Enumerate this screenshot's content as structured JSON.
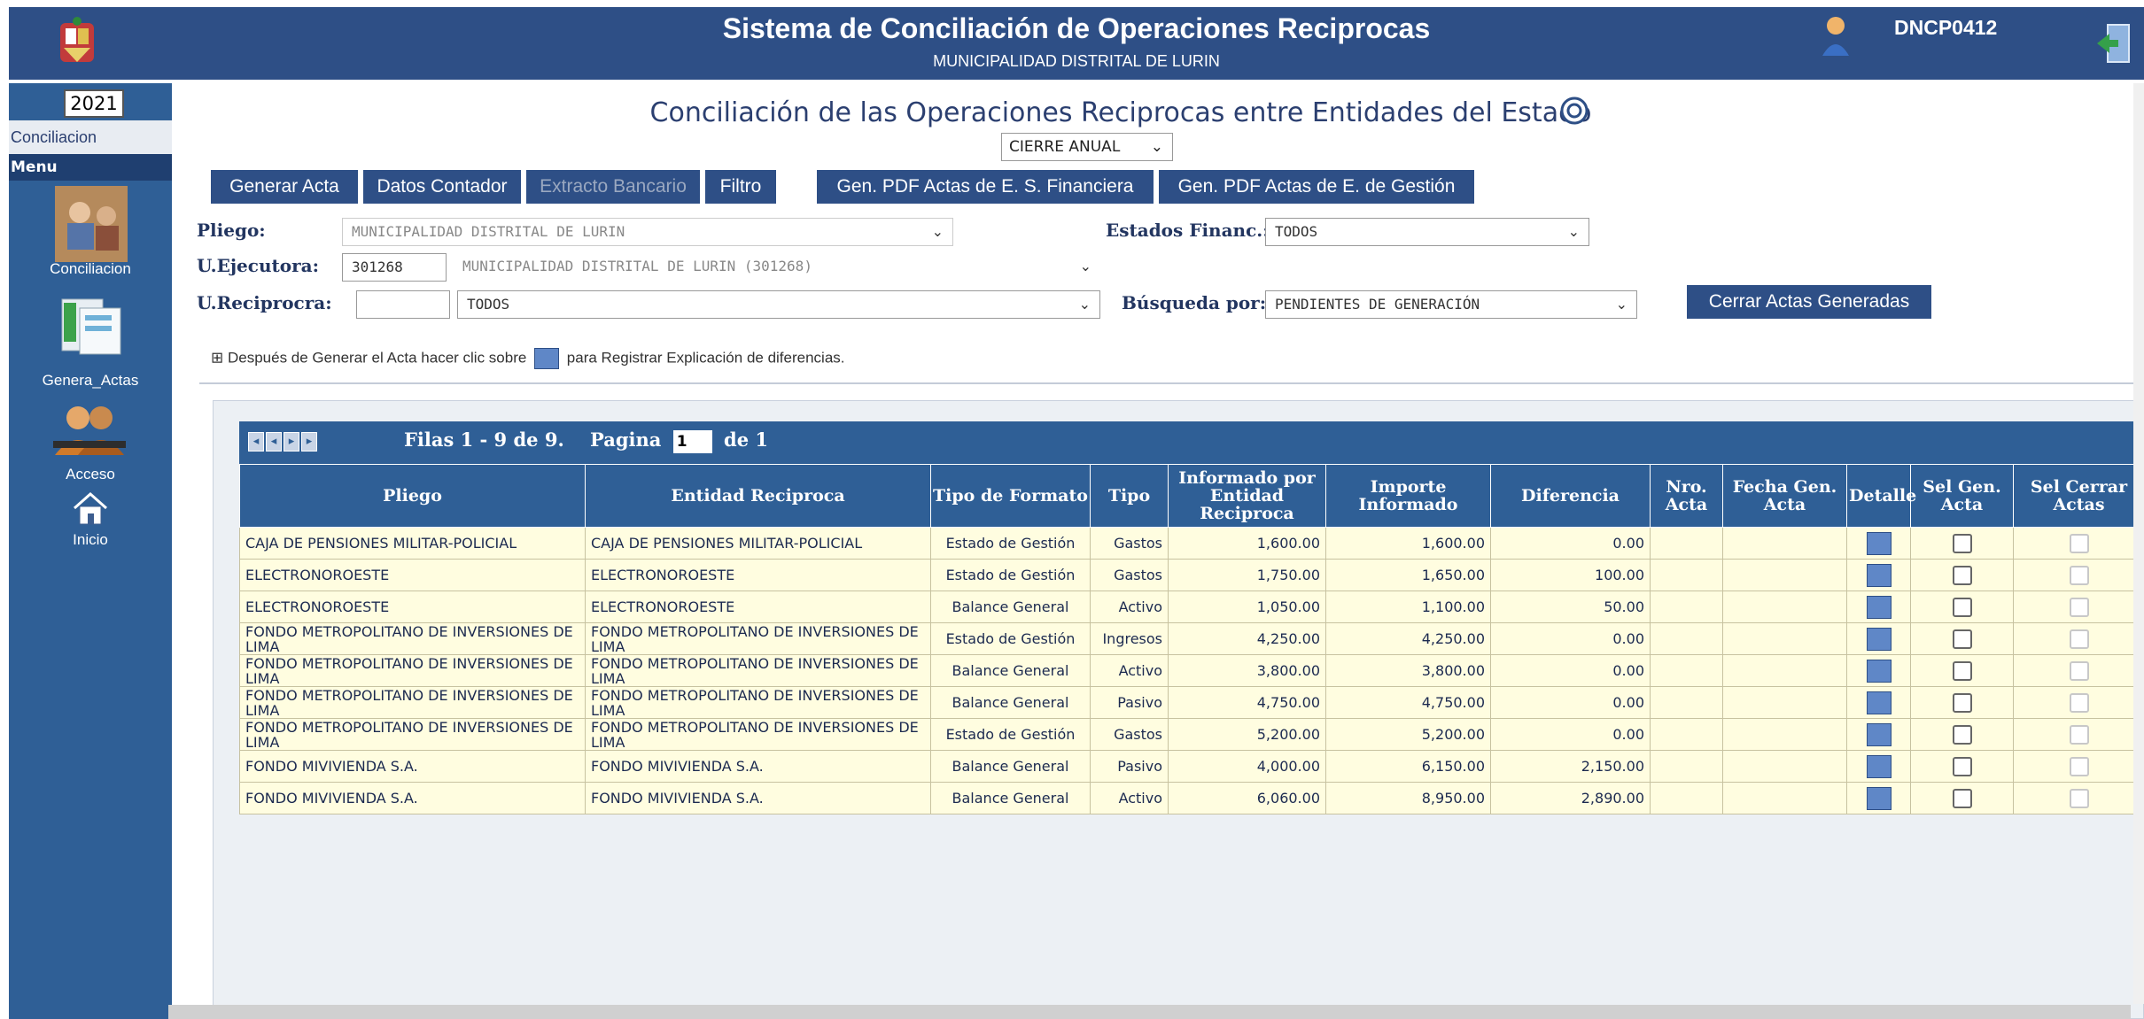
{
  "header": {
    "title": "Sistema de Conciliación de Operaciones Reciprocas",
    "subtitle": "MUNICIPALIDAD DISTRITAL DE LURIN",
    "user": "DNCP0412"
  },
  "sidebar": {
    "year": "2021",
    "section": "Conciliacion",
    "menu_label": "Menu",
    "items": [
      {
        "label": "Conciliacion"
      },
      {
        "label": "Genera_Actas"
      },
      {
        "label": "Acceso"
      },
      {
        "label": "Inicio"
      }
    ]
  },
  "main": {
    "heading": "Conciliación de las Operaciones Reciprocas entre Entidades del Estado",
    "period": "CIERRE ANUAL",
    "buttons": {
      "generar_acta": "Generar Acta",
      "datos_contador": "Datos Contador",
      "extracto_bancario": "Extracto Bancario",
      "filtro": "Filtro",
      "pdf_financiera": "Gen. PDF Actas de E. S. Financiera",
      "pdf_gestion": "Gen. PDF Actas de E. de Gestión",
      "cerrar_actas": "Cerrar Actas Generadas"
    },
    "filters": {
      "pliego_label": "Pliego:",
      "pliego_value": "MUNICIPALIDAD DISTRITAL DE LURIN",
      "ejecutora_label": "U.Ejecutora:",
      "ejecutora_code": "301268",
      "ejecutora_value": "MUNICIPALIDAD DISTRITAL DE LURIN (301268)",
      "reciproca_label": "U.Reciprocra:",
      "reciproca_code": "",
      "reciproca_value": "TODOS",
      "estados_label": "Estados Financ.:",
      "estados_value": "TODOS",
      "busqueda_label": "Búsqueda por:",
      "busqueda_value": "PENDIENTES DE GENERACIÓN"
    },
    "hint_before": "Después de Generar el Acta hacer clic sobre",
    "hint_after": "para Registrar Explicación de diferencias."
  },
  "grid": {
    "rows_info": "Filas 1 - 9 de 9.",
    "page_label": "Pagina",
    "page_value": "1",
    "page_total": "de 1",
    "columns": [
      "Pliego",
      "Entidad Reciproca",
      "Tipo de Formato",
      "Tipo",
      "Informado por Entidad Reciproca",
      "Importe Informado",
      "Diferencia",
      "Nro. Acta",
      "Fecha Gen. Acta",
      "Detalle",
      "Sel Gen. Acta",
      "Sel Cerrar Actas"
    ],
    "rows": [
      {
        "pliego": "CAJA DE PENSIONES MILITAR-POLICIAL",
        "entidad": "CAJA DE PENSIONES MILITAR-POLICIAL",
        "formato": "Estado de Gestión",
        "tipo": "Gastos",
        "informado_rec": "1,600.00",
        "importe": "1,600.00",
        "diferencia": "0.00"
      },
      {
        "pliego": "ELECTRONOROESTE",
        "entidad": "ELECTRONOROESTE",
        "formato": "Estado de Gestión",
        "tipo": "Gastos",
        "informado_rec": "1,750.00",
        "importe": "1,650.00",
        "diferencia": "100.00"
      },
      {
        "pliego": "ELECTRONOROESTE",
        "entidad": "ELECTRONOROESTE",
        "formato": "Balance General",
        "tipo": "Activo",
        "informado_rec": "1,050.00",
        "importe": "1,100.00",
        "diferencia": "50.00"
      },
      {
        "pliego": "FONDO METROPOLITANO DE INVERSIONES DE LIMA",
        "entidad": "FONDO METROPOLITANO DE INVERSIONES DE LIMA",
        "formato": "Estado de Gestión",
        "tipo": "Ingresos",
        "informado_rec": "4,250.00",
        "importe": "4,250.00",
        "diferencia": "0.00"
      },
      {
        "pliego": "FONDO METROPOLITANO DE INVERSIONES DE LIMA",
        "entidad": "FONDO METROPOLITANO DE INVERSIONES DE LIMA",
        "formato": "Balance General",
        "tipo": "Activo",
        "informado_rec": "3,800.00",
        "importe": "3,800.00",
        "diferencia": "0.00"
      },
      {
        "pliego": "FONDO METROPOLITANO DE INVERSIONES DE LIMA",
        "entidad": "FONDO METROPOLITANO DE INVERSIONES DE LIMA",
        "formato": "Balance General",
        "tipo": "Pasivo",
        "informado_rec": "4,750.00",
        "importe": "4,750.00",
        "diferencia": "0.00"
      },
      {
        "pliego": "FONDO METROPOLITANO DE INVERSIONES DE LIMA",
        "entidad": "FONDO METROPOLITANO DE INVERSIONES DE LIMA",
        "formato": "Estado de Gestión",
        "tipo": "Gastos",
        "informado_rec": "5,200.00",
        "importe": "5,200.00",
        "diferencia": "0.00"
      },
      {
        "pliego": "FONDO MIVIVIENDA S.A.",
        "entidad": "FONDO MIVIVIENDA S.A.",
        "formato": "Balance General",
        "tipo": "Pasivo",
        "informado_rec": "4,000.00",
        "importe": "6,150.00",
        "diferencia": "2,150.00"
      },
      {
        "pliego": "FONDO MIVIVIENDA S.A.",
        "entidad": "FONDO MIVIVIENDA S.A.",
        "formato": "Balance General",
        "tipo": "Activo",
        "informado_rec": "6,060.00",
        "importe": "8,950.00",
        "diferencia": "2,890.00"
      }
    ]
  }
}
